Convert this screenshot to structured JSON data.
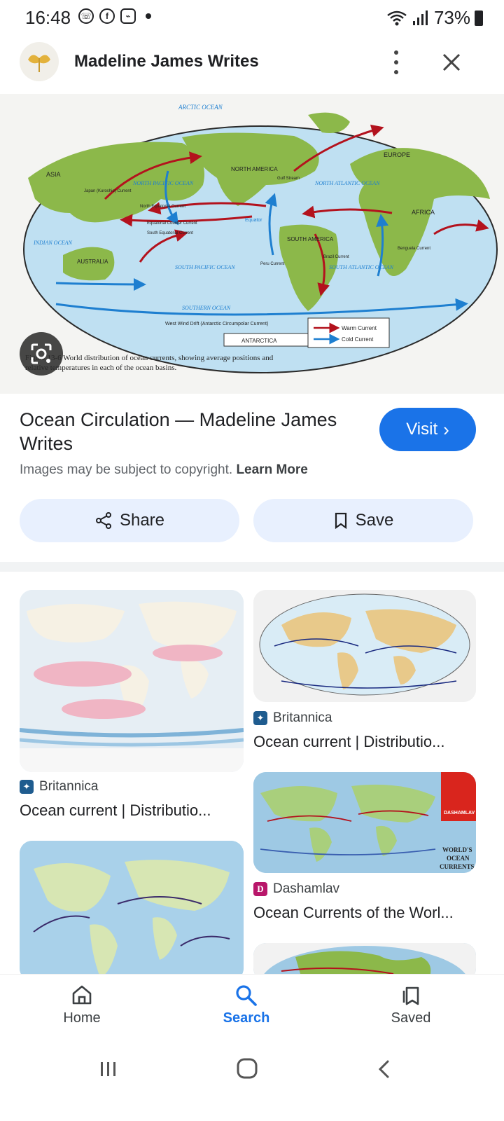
{
  "status_bar": {
    "time": "16:48",
    "notification_icons": [
      "whatsapp-icon",
      "facebook-icon",
      "messenger-icon"
    ],
    "battery": "73%"
  },
  "header": {
    "site_name": "Madeline James Writes"
  },
  "hero": {
    "map_labels": {
      "arctic": "ARCTIC OCEAN",
      "asia": "ASIA",
      "europe": "EUROPE",
      "africa": "AFRICA",
      "north_america": "NORTH AMERICA",
      "south_america": "SOUTH AMERICA",
      "australia": "AUSTRALIA",
      "antarctica": "ANTARCTICA",
      "north_pacific": "NORTH PACIFIC OCEAN",
      "south_pacific": "SOUTH PACIFIC OCEAN",
      "north_atlantic": "NORTH ATLANTIC OCEAN",
      "south_atlantic": "SOUTH ATLANTIC OCEAN",
      "indian": "INDIAN OCEAN",
      "southern": "SOUTHERN OCEAN",
      "equator": "Equator",
      "west_wind": "West Wind Drift (Antarctic Circumpolar Current)",
      "north_equatorial": "North Equatorial Current",
      "south_equatorial": "South Equatorial Current",
      "equatorial_counter": "Equatorial Counter Current",
      "gulf_stream": "Gulf Stream",
      "kuroshio": "Japan (Kuroshio) Current",
      "peru": "Peru Current",
      "brazil": "Brazil Current",
      "benguela": "Benguela Current"
    },
    "legend": {
      "warm": "Warm Current",
      "cold": "Cold Current"
    },
    "figure_caption_line1": "Figure 13-6 World distribution of ocean currents, showing average positions and",
    "figure_caption_line2": "relative temperatures in each of the ocean basins."
  },
  "result": {
    "title": "Ocean Circulation — Madeline James Writes",
    "visit_label": "Visit",
    "copyright_text": "Images may be subject to copyright.",
    "learn_more": "Learn More",
    "share_label": "Share",
    "save_label": "Save"
  },
  "related": [
    {
      "source": "Britannica",
      "title": "Ocean current | Distributio..."
    },
    {
      "source": "Britannica",
      "title": "Ocean current | Distributio..."
    },
    {
      "source": "Dashamlav",
      "title": "Ocean Currents of the Worl..."
    }
  ],
  "dashamlav_thumb": {
    "brand": "DASHAMLAV",
    "overlay_line1": "WORLD'S",
    "overlay_line2": "OCEAN",
    "overlay_line3": "CURRENTS"
  },
  "bottom_nav": {
    "home": "Home",
    "search": "Search",
    "saved": "Saved"
  },
  "colors": {
    "accent": "#1a73e8",
    "warm_current": "#b3121d",
    "cold_current": "#1e7fd0",
    "land": "#8cb84a",
    "ocean": "#bfe0f2"
  }
}
